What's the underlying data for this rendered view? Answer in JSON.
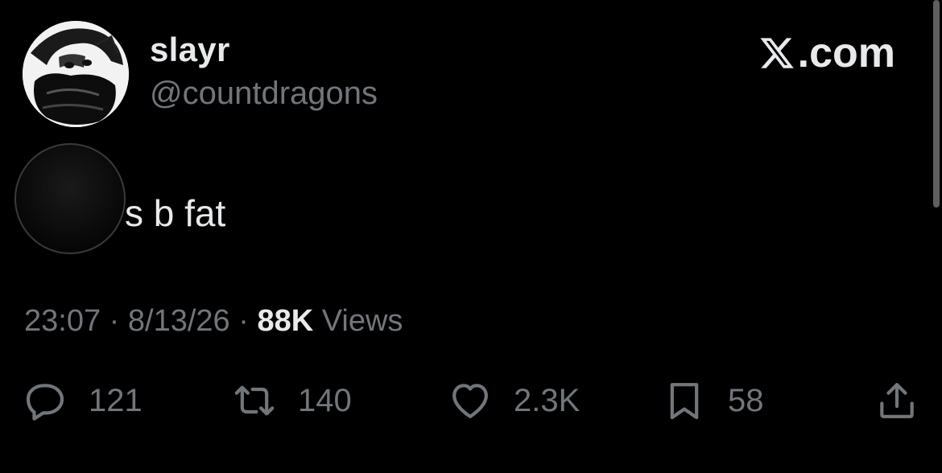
{
  "user": {
    "display_name": "slayr",
    "handle": "@countdragons"
  },
  "brand": {
    "logo_text": ".com",
    "icon": "x-logo-icon"
  },
  "tweet": {
    "text": "s b fat"
  },
  "meta": {
    "time": "23:07",
    "separator1": "·",
    "date": "8/13/26",
    "separator2": "·",
    "views_count": "88K",
    "views_label": "Views"
  },
  "actions": {
    "replies": "121",
    "reposts": "140",
    "likes": "2.3K",
    "bookmarks": "58"
  },
  "colors": {
    "background": "#000000",
    "primary_text": "#e7e9ea",
    "secondary_text": "#71767b"
  }
}
